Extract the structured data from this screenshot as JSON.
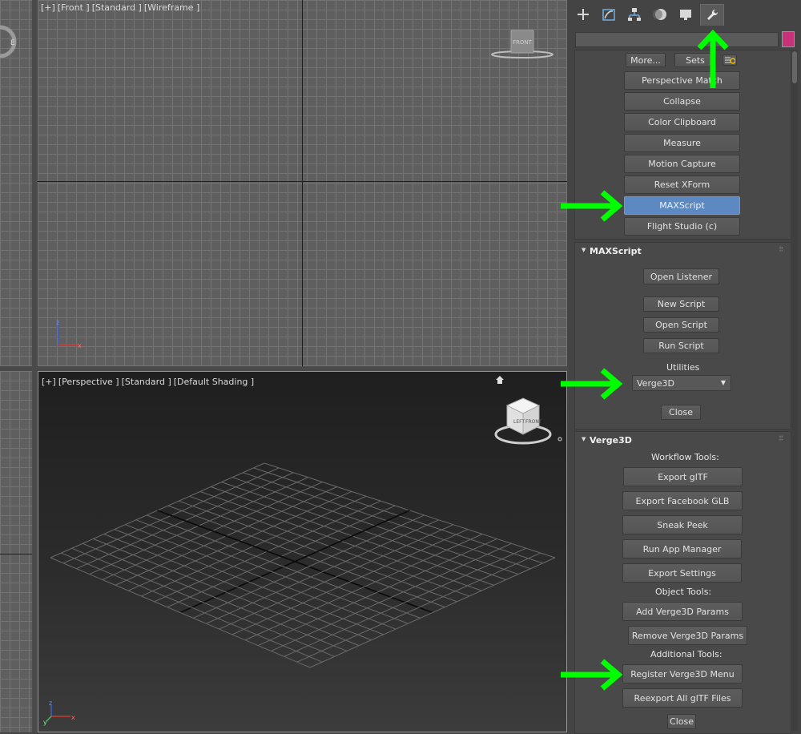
{
  "viewports": {
    "front": {
      "labels": [
        "[+]",
        "[Front ]",
        "[Standard ]",
        "[Wireframe ]"
      ],
      "viewcube_face": "FRONT"
    },
    "perspective": {
      "labels": [
        "[+]",
        "[Perspective ]",
        "[Standard ]",
        "[Default Shading ]"
      ],
      "viewcube_faces": [
        "LEFT",
        "FRONT"
      ]
    },
    "axis": {
      "x": "x",
      "y": "y",
      "z": "z"
    }
  },
  "command_panel": {
    "tabs": [
      {
        "name": "create",
        "icon": "plus-icon"
      },
      {
        "name": "modify",
        "icon": "modify-icon"
      },
      {
        "name": "hierarchy",
        "icon": "hierarchy-icon"
      },
      {
        "name": "motion",
        "icon": "motion-icon"
      },
      {
        "name": "display",
        "icon": "display-icon"
      },
      {
        "name": "utilities",
        "icon": "wrench-icon",
        "active": true
      }
    ],
    "swatch_color": "#c8307a"
  },
  "utilities": {
    "more_label": "More...",
    "sets_label": "Sets",
    "buttons": [
      "Perspective Match",
      "Collapse",
      "Color Clipboard",
      "Measure",
      "Motion Capture",
      "Reset XForm",
      "MAXScript",
      "Flight Studio (c)"
    ],
    "selected": "MAXScript"
  },
  "maxscript": {
    "title": "MAXScript",
    "open_listener": "Open Listener",
    "new_script": "New Script",
    "open_script": "Open Script",
    "run_script": "Run Script",
    "utilities_label": "Utilities",
    "utilities_selected": "Verge3D",
    "close": "Close"
  },
  "verge3d": {
    "title": "Verge3D",
    "workflow_label": "Workflow Tools:",
    "workflow": [
      "Export glTF",
      "Export Facebook GLB",
      "Sneak Peek",
      "Run App Manager",
      "Export Settings"
    ],
    "object_label": "Object Tools:",
    "object": [
      "Add Verge3D Params",
      "Remove Verge3D Params"
    ],
    "additional_label": "Additional Tools:",
    "additional": [
      "Register Verge3D Menu",
      "Reexport All glTF Files"
    ],
    "close": "Close"
  },
  "annotation_color": "#00ff00"
}
